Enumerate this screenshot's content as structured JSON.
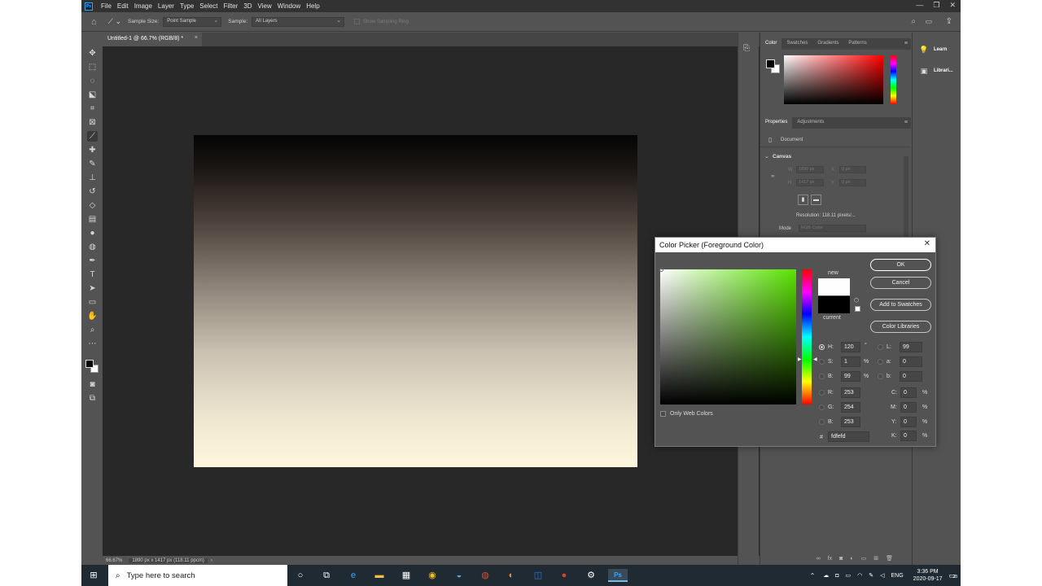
{
  "app": {
    "logo": "Ps"
  },
  "menu": [
    "File",
    "Edit",
    "Image",
    "Layer",
    "Type",
    "Select",
    "Filter",
    "3D",
    "View",
    "Window",
    "Help"
  ],
  "window_controls": [
    "—",
    "❐",
    "✕"
  ],
  "options": {
    "sample_size_label": "Sample Size:",
    "sample_size_value": "Point Sample",
    "sample_label": "Sample:",
    "sample_value": "All Layers",
    "show_sampling_ring": "Show Sampling Ring"
  },
  "document": {
    "tab_title": "Untitled-1 @ 66.7% (RGB/8) *",
    "tab_close": "×",
    "zoom": "66.67%",
    "dimensions_info": "1890 px x 1417 px (118.11 ppcm)",
    "status_arrow": "›",
    "canvas_gradient": {
      "top": "#050404",
      "bottom": "#fff7dc"
    }
  },
  "color_panel": {
    "tabs": [
      "Color",
      "Swatches",
      "Gradients",
      "Patterns"
    ],
    "panel_menu": "≡"
  },
  "properties_panel": {
    "tabs": [
      "Properties",
      "Adjustments"
    ],
    "document_label": "Document",
    "canvas_label": "Canvas",
    "canvas_toggle": "⌄",
    "w_label": "W",
    "w_value": "1890 px",
    "h_label": "H",
    "h_value": "1417 px",
    "x_label": "X",
    "x_value": "0 px",
    "y_label": "Y",
    "y_value": "0 px",
    "resolution": "Resolution: 118.11 pixels/...",
    "mode_label": "Mode",
    "mode_value": "RGB Color"
  },
  "far_panel": {
    "items": [
      "Learn",
      "Librari..."
    ]
  },
  "color_picker": {
    "title": "Color Picker (Foreground Color)",
    "close": "✕",
    "new_label": "new",
    "current_label": "current",
    "new_color": "#fdfefd",
    "current_color": "#000000",
    "buttons": {
      "ok": "OK",
      "cancel": "Cancel",
      "add_swatches": "Add to Swatches",
      "libraries": "Color Libraries"
    },
    "only_web_colors": "Only Web Colors",
    "hue_base_color": "#59e300",
    "fields": {
      "H": {
        "label": "H:",
        "value": "120",
        "unit": "°"
      },
      "S": {
        "label": "S:",
        "value": "1",
        "unit": "%"
      },
      "Bv": {
        "label": "B:",
        "value": "99",
        "unit": "%"
      },
      "R": {
        "label": "R:",
        "value": "253"
      },
      "G": {
        "label": "G:",
        "value": "254"
      },
      "Bc": {
        "label": "B:",
        "value": "253"
      },
      "L": {
        "label": "L:",
        "value": "99"
      },
      "a": {
        "label": "a:",
        "value": "0"
      },
      "b": {
        "label": "b:",
        "value": "0"
      },
      "C": {
        "label": "C:",
        "value": "0",
        "unit": "%"
      },
      "M": {
        "label": "M:",
        "value": "0",
        "unit": "%"
      },
      "Y": {
        "label": "Y:",
        "value": "0",
        "unit": "%"
      },
      "K": {
        "label": "K:",
        "value": "0",
        "unit": "%"
      },
      "hex": {
        "label": "#",
        "value": "fdfefd"
      }
    }
  },
  "taskbar": {
    "search_placeholder": "Type here to search",
    "time": "3:36 PM",
    "date": "2020-09-17",
    "lang": "ENG",
    "notifications": "23"
  }
}
